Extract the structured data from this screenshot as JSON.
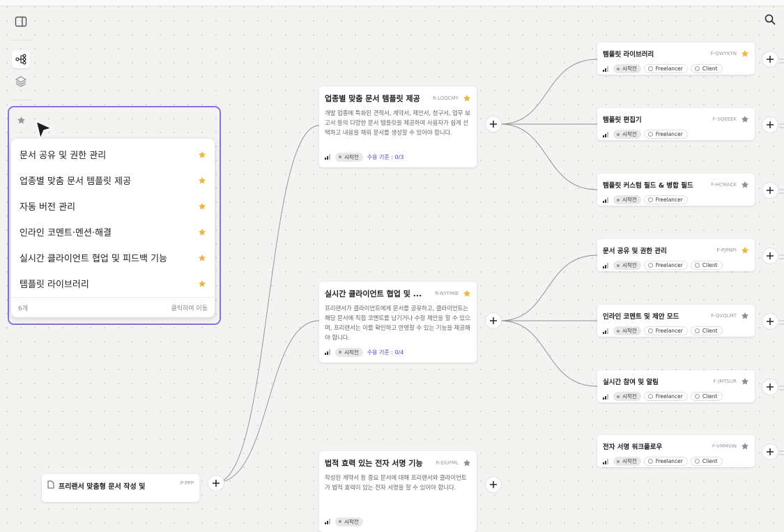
{
  "rail": {
    "icons": [
      "sidebar-toggle-icon",
      "tree-view-icon",
      "layers-icon",
      "star-icon"
    ]
  },
  "favorites": {
    "items": [
      {
        "label": "문서 공유 및 권한 관리"
      },
      {
        "label": "업종별 맞춤 문서 템플릿 제공"
      },
      {
        "label": "자동 버전 관리"
      },
      {
        "label": "인라인 코멘트·멘션·해결"
      },
      {
        "label": "실시간 클라이언트 협업 및 피드백 기능"
      },
      {
        "label": "템플릿 라이브러리"
      }
    ],
    "count": "6개",
    "hint": "클릭하여 이동"
  },
  "root_node": {
    "title": "프리랜서 맞춤형 문서 작성 및",
    "code": "P-PPP"
  },
  "requirements": [
    {
      "title": "업종별 맞춤 문서 템플릿 제공",
      "code": "R-LOQCMY",
      "starred": true,
      "desc": "개발 업종에 특화된 견적서, 계약서, 제안서, 청구서, 업무 보고서 등의 다양한 문서 템플릿을 제공하여 사용자가 쉽게 선택하고 내용을 채워 문서를 생성할 수 있어야 합니다.",
      "status": "시작전",
      "criteria": "수용 기준 : 0/3"
    },
    {
      "title": "실시간 클라이언트 협업 및 ...",
      "code": "R-NYFMIB",
      "starred": true,
      "desc": "프리랜서가 클라이언트에게 문서를 공유하고, 클라이언트는 해당 문서에 직접 코멘트를 남기거나 수정 제안을 할 수 있으며, 프리랜서는 이를 확인하고 반영할 수 있는 기능을 제공해야 합니다.",
      "status": "시작전",
      "criteria": "수용 기준 : 0/4"
    },
    {
      "title": "법적 효력 있는 전자 서명 기능",
      "code": "R-EIUFML",
      "starred": false,
      "desc": "작성된 계약서 등 중요 문서에 대해 프리랜서와 클라이언트가 법적 효력이 있는 전자 서명을 할 수 있어야 합니다.",
      "status": "시작전",
      "criteria": ""
    }
  ],
  "features": [
    {
      "title": "템플릿 라이브러리",
      "code": "F-QWYKYN",
      "starred": true,
      "status": "시작전",
      "roles": [
        "Freelancer",
        "Client"
      ]
    },
    {
      "title": "템플릿 편집기",
      "code": "F-SQEEEK",
      "starred": false,
      "status": "시작전",
      "roles": [
        "Freelancer"
      ]
    },
    {
      "title": "템플릿 커스텀 필드 & 병합 필드",
      "code": "F-HCMACK",
      "starred": false,
      "status": "시작전",
      "roles": [
        "Freelancer"
      ]
    },
    {
      "title": "문서 공유 및 권한 관리",
      "code": "F-PJPNPI",
      "starred": true,
      "status": "시작전",
      "roles": [
        "Freelancer",
        "Client"
      ]
    },
    {
      "title": "인라인 코멘트 및 제안 모드",
      "code": "F-QVQLMT",
      "starred": false,
      "status": "시작전",
      "roles": [
        "Freelancer",
        "Client"
      ]
    },
    {
      "title": "실시간 참여 및 알림",
      "code": "F-JMTSUR",
      "starred": false,
      "status": "시작전",
      "roles": [
        "Freelancer",
        "Client"
      ]
    },
    {
      "title": "전자 서명 워크플로우",
      "code": "F-VMMVIN",
      "starred": false,
      "status": "시작전",
      "roles": [
        "Freelancer",
        "Client"
      ]
    }
  ],
  "colors": {
    "accent": "#8a6ee6",
    "star_on": "#f0b63d",
    "star_off": "#8e8e8e",
    "criteria": "#4a3fd0"
  }
}
